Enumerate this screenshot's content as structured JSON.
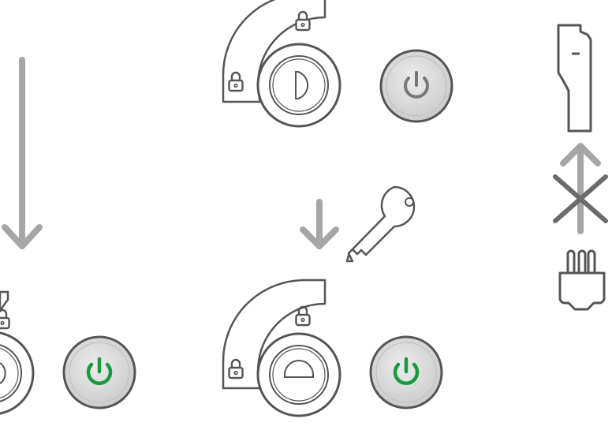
{
  "colors": {
    "outline": "#555555",
    "arrow": "#a6a6a6",
    "cross": "#6b6b6b",
    "button_fill": "#d9d9d9",
    "button_inner": "#cfcfcf",
    "power_off": "#777777",
    "power_on": "#1a9a3f",
    "background": "#ffffff"
  },
  "panels": [
    {
      "id": "top-lock",
      "key_slot": "vertical",
      "power_state": "off"
    },
    {
      "id": "bottom-left-lock",
      "key_slot": "partial",
      "power_state": "on"
    },
    {
      "id": "bottom-right-lock",
      "key_slot": "horizontal",
      "power_state": "on"
    }
  ],
  "icons": {
    "padlock": "padlock-icon",
    "power": "power-icon",
    "key": "key-icon",
    "arrow_down": "arrow-down-icon",
    "arrow_up": "arrow-up-icon",
    "cross": "cross-icon",
    "plug": "plug-icon",
    "socket": "socket-icon"
  }
}
